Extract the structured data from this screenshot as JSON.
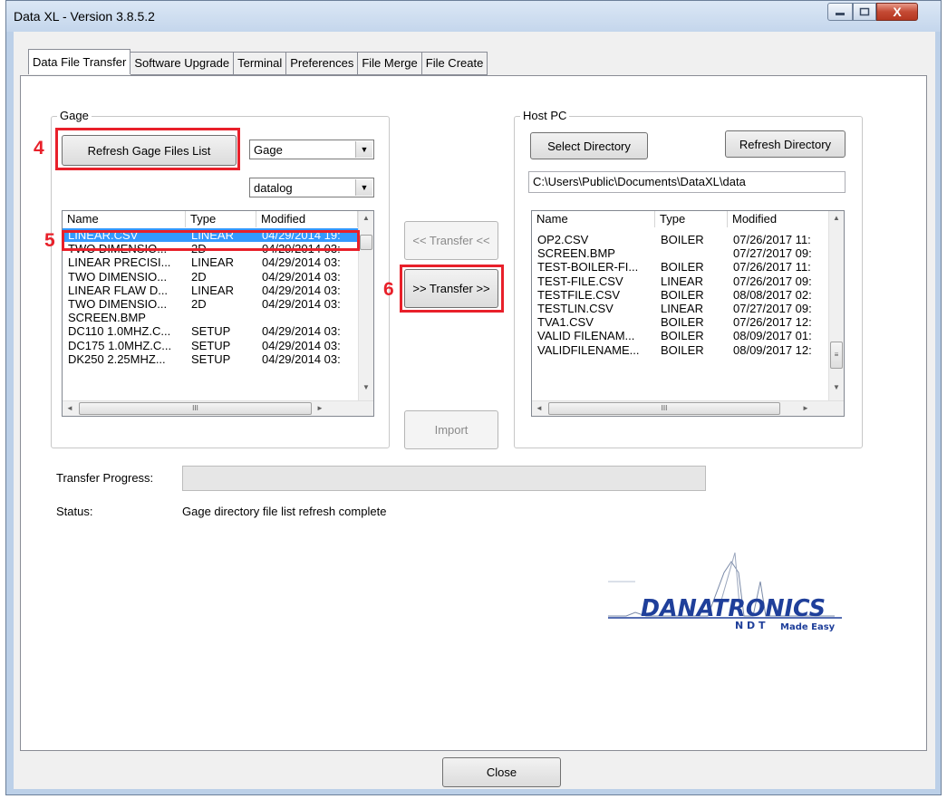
{
  "window": {
    "title": "Data XL - Version 3.8.5.2",
    "close_glyph": "X"
  },
  "tabs": [
    "Data File Transfer",
    "Software Upgrade",
    "Terminal",
    "Preferences",
    "File Merge",
    "File Create"
  ],
  "gage": {
    "group_label": "Gage",
    "refresh_button": "Refresh Gage Files List",
    "device_combo": "Gage",
    "folder_combo": "datalog",
    "columns": [
      "Name",
      "Type",
      "Modified"
    ],
    "rows": [
      {
        "name": "LINEAR.CSV",
        "type": "LINEAR",
        "modified": "04/29/2014 19:"
      },
      {
        "name": "TWO DIMENSIO...",
        "type": "2D",
        "modified": "04/29/2014 03:"
      },
      {
        "name": "LINEAR PRECISI...",
        "type": "LINEAR",
        "modified": "04/29/2014 03:"
      },
      {
        "name": "TWO DIMENSIO...",
        "type": "2D",
        "modified": "04/29/2014 03:"
      },
      {
        "name": "LINEAR FLAW D...",
        "type": "LINEAR",
        "modified": "04/29/2014 03:"
      },
      {
        "name": "TWO DIMENSIO...",
        "type": "2D",
        "modified": "04/29/2014 03:"
      },
      {
        "name": "SCREEN.BMP",
        "type": "",
        "modified": ""
      },
      {
        "name": "DC110 1.0MHZ.C...",
        "type": "SETUP",
        "modified": "04/29/2014 03:"
      },
      {
        "name": "DC175 1.0MHZ.C...",
        "type": "SETUP",
        "modified": "04/29/2014 03:"
      },
      {
        "name": "DK250 2.25MHZ...",
        "type": "SETUP",
        "modified": "04/29/2014 03:"
      }
    ],
    "selected_index": 0
  },
  "middle": {
    "transfer_left": "<< Transfer <<",
    "transfer_right": ">> Transfer >>",
    "import": "Import"
  },
  "host": {
    "group_label": "Host PC",
    "select_directory": "Select Directory",
    "refresh_directory": "Refresh Directory",
    "path": "C:\\Users\\Public\\Documents\\DataXL\\data",
    "columns": [
      "Name",
      "Type",
      "Modified"
    ],
    "rows": [
      {
        "name": "OP2.CSV",
        "type": "BOILER",
        "modified": "07/26/2017 11:"
      },
      {
        "name": "SCREEN.BMP",
        "type": "",
        "modified": "07/27/2017 09:"
      },
      {
        "name": "TEST-BOILER-FI...",
        "type": "BOILER",
        "modified": "07/26/2017 11:"
      },
      {
        "name": "TEST-FILE.CSV",
        "type": "LINEAR",
        "modified": "07/26/2017 09:"
      },
      {
        "name": "TESTFILE.CSV",
        "type": "BOILER",
        "modified": "08/08/2017 02:"
      },
      {
        "name": "TESTLIN.CSV",
        "type": "LINEAR",
        "modified": "07/27/2017 09:"
      },
      {
        "name": "TVA1.CSV",
        "type": "BOILER",
        "modified": "07/26/2017 12:"
      },
      {
        "name": "VALID FILENAM...",
        "type": "BOILER",
        "modified": "08/09/2017 01:"
      },
      {
        "name": "VALIDFILENAME...",
        "type": "BOILER",
        "modified": "08/09/2017 12:"
      }
    ]
  },
  "progress": {
    "label": "Transfer Progress:",
    "value": 0
  },
  "status": {
    "label": "Status:",
    "text": "Gage directory file list refresh complete"
  },
  "annotations": [
    "4",
    "5",
    "6"
  ],
  "logo": {
    "brand": "DANATRONICS",
    "sub": "N D T",
    "tagline": "Made Easy"
  },
  "close_button": "Close",
  "scroll_glyph": "III",
  "colors": {
    "annotation_red": "#e8202a",
    "selection_blue": "#3399ff",
    "logo_blue": "#1f3f9a"
  }
}
